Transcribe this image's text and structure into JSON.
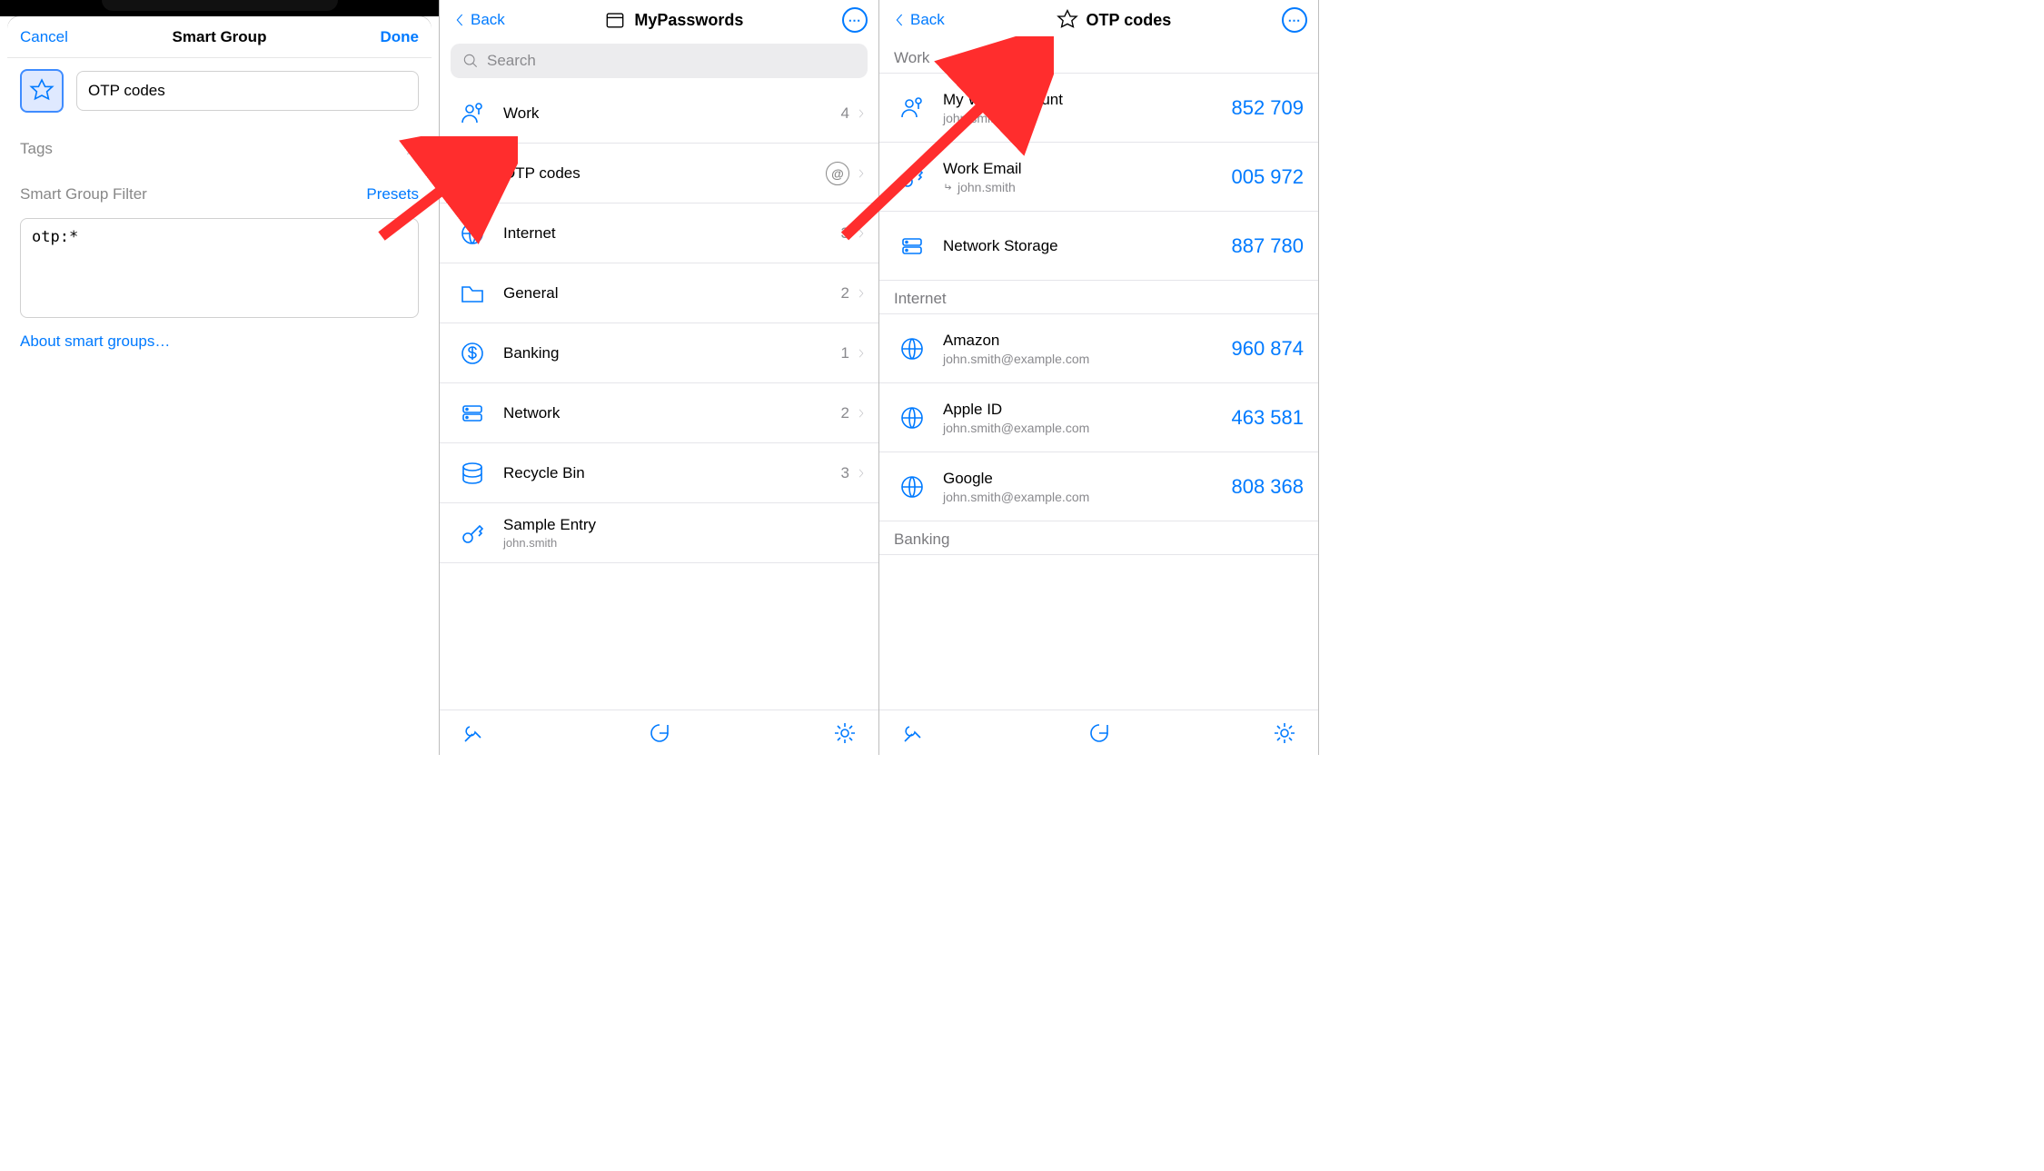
{
  "panel1": {
    "cancel": "Cancel",
    "title": "Smart Group",
    "done": "Done",
    "group_name": "OTP codes",
    "tags_label": "Tags",
    "filter_label": "Smart Group Filter",
    "presets": "Presets",
    "filter_value": "otp:*",
    "about_link": "About smart groups…"
  },
  "panel2": {
    "back": "Back",
    "title": "MyPasswords",
    "search_placeholder": "Search",
    "items": [
      {
        "icon": "person-key",
        "label": "Work",
        "count": "4"
      },
      {
        "icon": "star",
        "label": "OTP codes",
        "at": true
      },
      {
        "icon": "globe",
        "label": "Internet",
        "count": "3"
      },
      {
        "icon": "folder",
        "label": "General",
        "count": "2"
      },
      {
        "icon": "dollar",
        "label": "Banking",
        "count": "1"
      },
      {
        "icon": "server",
        "label": "Network",
        "count": "2"
      },
      {
        "icon": "db",
        "label": "Recycle Bin",
        "count": "3"
      },
      {
        "icon": "key",
        "label": "Sample Entry",
        "sub": "john.smith"
      }
    ]
  },
  "panel3": {
    "back": "Back",
    "title": "OTP codes",
    "sections": [
      {
        "header": "Work",
        "entries": [
          {
            "icon": "person-key",
            "title": "My Work Account",
            "sub": "john.smith",
            "code": "852 709"
          },
          {
            "icon": "key",
            "title": "Work Email",
            "sub": "john.smith",
            "ref": true,
            "code": "005 972"
          },
          {
            "icon": "server",
            "title": "Network Storage",
            "code": "887 780"
          }
        ]
      },
      {
        "header": "Internet",
        "entries": [
          {
            "icon": "globe",
            "title": "Amazon",
            "sub": "john.smith@example.com",
            "code": "960 874"
          },
          {
            "icon": "globe",
            "title": "Apple ID",
            "sub": "john.smith@example.com",
            "code": "463 581"
          },
          {
            "icon": "globe",
            "title": "Google",
            "sub": "john.smith@example.com",
            "code": "808 368"
          }
        ]
      },
      {
        "header": "Banking",
        "entries": []
      }
    ]
  }
}
